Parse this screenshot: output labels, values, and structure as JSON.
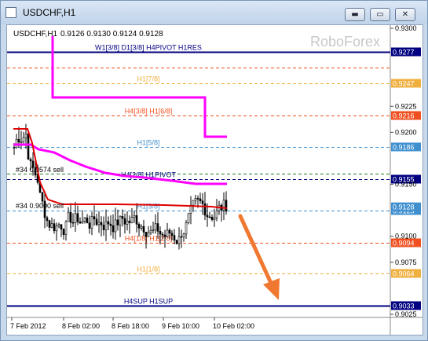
{
  "window": {
    "title": "USDCHF,H1",
    "buttons": {
      "minimize": "▬",
      "maximize": "▭",
      "close": "✕"
    }
  },
  "chart_info": {
    "symbol_tf": "USDCHF,H1",
    "ohlc": "0.9126 0.9130 0.9124 0.9128",
    "watermark": "RoboForex"
  },
  "annotations": {
    "sell1": "#34 0.0574 sell",
    "sell2": "#34 0.9000 sell"
  },
  "levels": [
    {
      "label": "W1[3/8] D1[3/8] H4PIVOT H1RES",
      "price": 0.9277,
      "price_label": "0.9277",
      "color": "#000080"
    },
    {
      "label": "",
      "price": 0.9262,
      "price_label": "",
      "color": "#e85020"
    },
    {
      "label": "H1[7/8]",
      "price": 0.9247,
      "price_label": "0.9247",
      "color": "#f0b040"
    },
    {
      "label": "H4[3/8] H1[6/8]",
      "price": 0.9216,
      "price_label": "0.9216",
      "color": "#f05020"
    },
    {
      "label": "H1[5/8]",
      "price": 0.9186,
      "price_label": "0.9186",
      "color": "#4090d0"
    },
    {
      "label": "",
      "price": 0.916,
      "price_label": "",
      "color": "#208020"
    },
    {
      "label": "H4[2/8] H1PIVOT",
      "price": 0.9155,
      "price_label": "0.9155",
      "color": "#000080"
    },
    {
      "label": "H1[3/8]",
      "price": 0.9125,
      "price_label": "0.9125",
      "color": "#4090d0"
    },
    {
      "label": "H4[1/8] H1[2/8]",
      "price": 0.9094,
      "price_label": "0.9094",
      "color": "#f05020"
    },
    {
      "label": "H1[1/8]",
      "price": 0.9064,
      "price_label": "0.9064",
      "color": "#f0b040"
    },
    {
      "label": "H4SUP H1SUP",
      "price": 0.9033,
      "price_label": "0.9033",
      "color": "#000080"
    }
  ],
  "current_price": {
    "label": "0.9128",
    "price": 0.9128
  },
  "price_axis": {
    "ticks": [
      "0.9300",
      "0.9225",
      "0.9200",
      "0.9150",
      "0.9100",
      "0.9075",
      "0.9025"
    ],
    "tick_values": [
      0.93,
      0.9225,
      0.92,
      0.915,
      0.91,
      0.9075,
      0.9025
    ]
  },
  "time_axis": {
    "ticks": [
      "7 Feb 2012",
      "8 Feb 02:00",
      "8 Feb 18:00",
      "9 Feb 10:00",
      "10 Feb 02:00"
    ]
  },
  "colors": {
    "magenta": "#ff00ff",
    "red_ma": "#e00000",
    "arrow": "#f07830",
    "candle": "#000000"
  }
}
